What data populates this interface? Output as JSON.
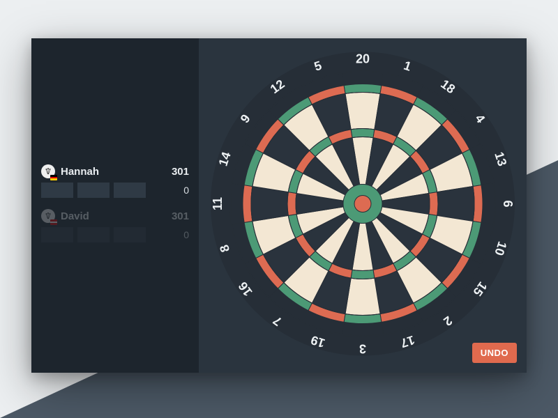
{
  "players": [
    {
      "name": "Hannah",
      "score": "301",
      "turn": "0",
      "active": true,
      "flag": [
        "#000000",
        "#dd0000",
        "#ffce00"
      ]
    },
    {
      "name": "David",
      "score": "301",
      "turn": "0",
      "active": false,
      "flag": [
        "#dd0000",
        "#ffffff",
        "#dd0000"
      ]
    }
  ],
  "buttons": {
    "undo": "UNDO"
  },
  "board": {
    "numbers": [
      20,
      1,
      18,
      4,
      13,
      6,
      10,
      15,
      2,
      17,
      3,
      19,
      7,
      16,
      8,
      11,
      14,
      9,
      12,
      5
    ],
    "colors": {
      "cream": "#f3e7d3",
      "dark": "#2a333d",
      "green": "#4c9a76",
      "red": "#dd6b52",
      "ring": "#262e37",
      "wire": "#262e37"
    }
  }
}
